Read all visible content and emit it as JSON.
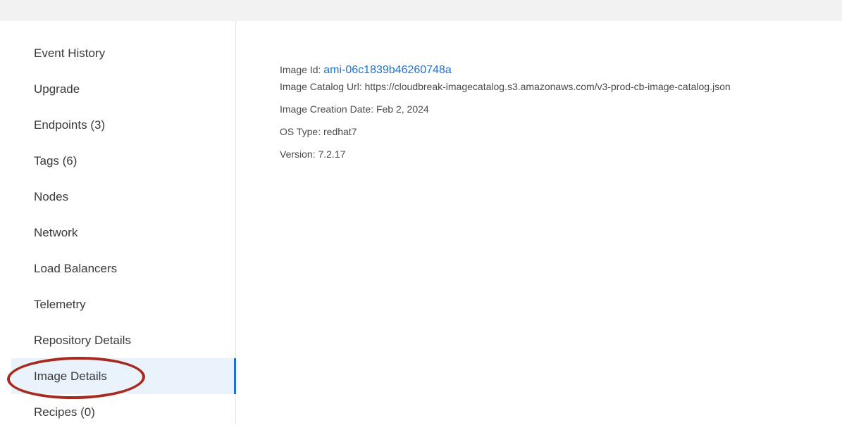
{
  "sidebar": {
    "items": [
      {
        "label": "Event History"
      },
      {
        "label": "Upgrade"
      },
      {
        "label": "Endpoints (3)"
      },
      {
        "label": "Tags (6)"
      },
      {
        "label": "Nodes"
      },
      {
        "label": "Network"
      },
      {
        "label": "Load Balancers"
      },
      {
        "label": "Telemetry"
      },
      {
        "label": "Repository Details"
      },
      {
        "label": "Image Details",
        "active": true
      },
      {
        "label": "Recipes (0)"
      }
    ]
  },
  "image_details": {
    "image_id_label": "Image Id:",
    "image_id_value": "ami-06c1839b46260748a",
    "catalog_url_label": "Image Catalog Url:",
    "catalog_url_value": "https://cloudbreak-imagecatalog.s3.amazonaws.com/v3-prod-cb-image-catalog.json",
    "creation_date_label": "Image Creation Date:",
    "creation_date_value": "Feb 2, 2024",
    "os_type_label": "OS Type:",
    "os_type_value": "redhat7",
    "version_label": "Version:",
    "version_value": "7.2.17"
  },
  "colors": {
    "accent": "#1a73d9",
    "active_item_bg": "#eaf2fb",
    "annotation_ellipse": "#a52a1f"
  }
}
